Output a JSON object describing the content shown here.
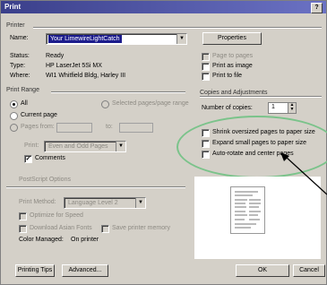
{
  "window": {
    "title": "Print",
    "help": "?"
  },
  "printer": {
    "group_label": "Printer",
    "name_label": "Name:",
    "name_value": "Your LimewireLightCatch",
    "properties_button": "Properties",
    "status_label": "Status:",
    "status_value": "Ready",
    "type_label": "Type:",
    "type_value": "HP LaserJet 5Si MX",
    "where_label": "Where:",
    "where_value": "WI1 Whitfield Bldg, Harley III",
    "print_to_pages": "Page to pages",
    "print_as_image": "Print as image",
    "print_to_file": "Print to file"
  },
  "print_range": {
    "group_label": "Print Range",
    "all": "All",
    "current_page": "Current page",
    "pages": "Pages from:",
    "to": "to:",
    "selected_pages": "Selected pages/page range",
    "print_label": "Print:",
    "print_value": "Even and Odd Pages",
    "comments": "Comments"
  },
  "postscript": {
    "group_label": "PostScript Options",
    "print_method_label": "Print Method:",
    "print_method_value": "Language Level 2",
    "optimize_speed": "Optimize for Speed",
    "download_fonts": "Download Asian Fonts",
    "save_memory": "Save printer memory",
    "color_managed": "Color Managed:",
    "color_managed_value": "On printer"
  },
  "copies": {
    "group_label": "Copies and Adjustments",
    "number_label": "Number of copies:",
    "number_value": "1",
    "shrink": "Shrink oversized pages to paper size",
    "expand": "Expand small pages to paper size",
    "autorotate": "Auto-rotate and center pages"
  },
  "buttons": {
    "printing_tips": "Printing Tips",
    "advanced": "Advanced...",
    "ok": "OK",
    "cancel": "Cancel"
  }
}
